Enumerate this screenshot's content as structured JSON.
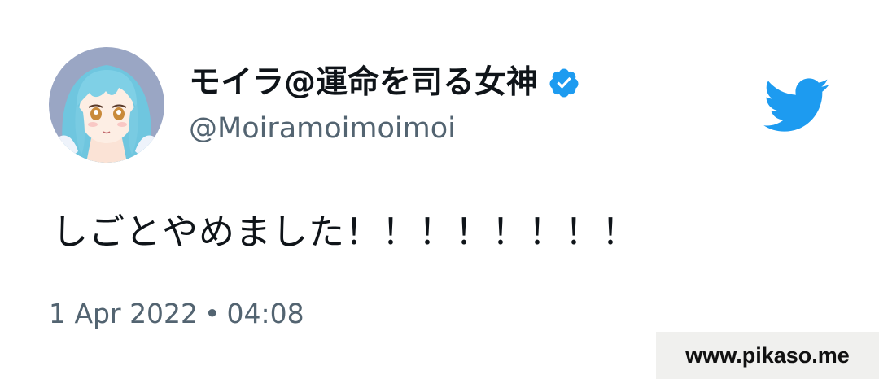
{
  "tweet": {
    "display_name": "モイラ@運命を司る女神",
    "handle": "@Moiramoimoimoi",
    "text": "しごとやめました！！！！！！！！",
    "date": "1 Apr 2022",
    "separator": "•",
    "time": "04:08",
    "verified": true
  },
  "icons": {
    "avatar": "anime-girl-avatar",
    "verified": "verified-badge-icon",
    "brand": "twitter-bird-icon"
  },
  "watermark": {
    "text": "www.pikaso.me"
  },
  "colors": {
    "twitter_blue": "#1d9bf0",
    "text_primary": "#0f1419",
    "text_secondary": "#536471",
    "watermark_bg": "#f0f0ee"
  }
}
